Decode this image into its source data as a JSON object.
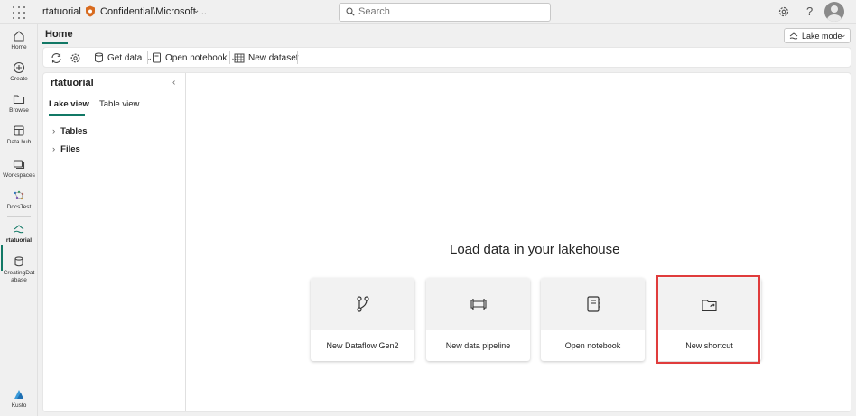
{
  "topbar": {
    "app_name": "rtatuorial",
    "sensitivity_label": "Confidential\\Microsoft ...",
    "search_placeholder": "Search",
    "help_symbol": "?"
  },
  "leftnav": {
    "items": [
      {
        "label": "Home",
        "icon": "home-icon"
      },
      {
        "label": "Create",
        "icon": "plus-circle-icon"
      },
      {
        "label": "Browse",
        "icon": "folder-icon"
      },
      {
        "label": "Data hub",
        "icon": "data-hub-icon"
      },
      {
        "label": "Workspaces",
        "icon": "workspaces-icon"
      },
      {
        "label": "DocsTest",
        "icon": "workspace-docs-icon"
      },
      {
        "label": "rtatuorial",
        "icon": "lakehouse-icon"
      },
      {
        "label": "CreatingDat abase",
        "icon": "database-icon"
      },
      {
        "label": "Kusto",
        "icon": "kusto-icon"
      }
    ]
  },
  "ribbon": {
    "home_tab": "Home",
    "lake_mode": "Lake mode",
    "toolbar": {
      "get_data": "Get data",
      "open_notebook": "Open notebook",
      "new_dataset": "New dataset"
    }
  },
  "explorer": {
    "title": "rtatuorial",
    "tabs": [
      "Lake view",
      "Table view"
    ],
    "tree": [
      "Tables",
      "Files"
    ]
  },
  "main": {
    "heading": "Load data in your lakehouse",
    "cards": [
      {
        "label": "New Dataflow Gen2",
        "icon": "dataflow-icon"
      },
      {
        "label": "New data pipeline",
        "icon": "pipeline-icon"
      },
      {
        "label": "Open notebook",
        "icon": "notebook-icon"
      },
      {
        "label": "New shortcut",
        "icon": "shortcut-folder-icon"
      }
    ]
  },
  "colors": {
    "accent": "#117865",
    "highlight_border": "#e03c3c"
  }
}
